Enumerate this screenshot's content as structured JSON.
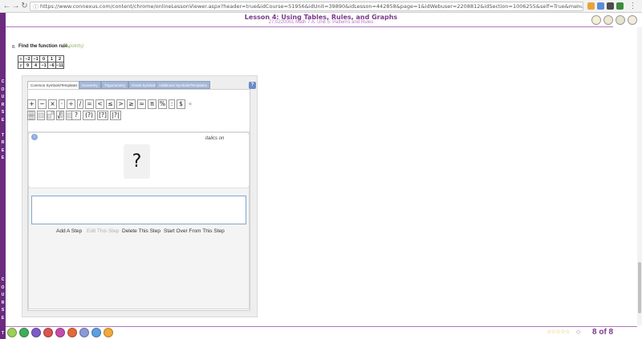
{
  "browser": {
    "url": "https://www.connexus.com/content/chrome/onlineLessonViewer.aspx?header=true&idCourse=51956&idUnit=39890&idLesson=442858&page=1&idWebuser=2208812&idSection=1006255&self=True&menu=off&resizeWindow=true"
  },
  "sidebar": {
    "label_top": [
      "C",
      "O",
      "U",
      "R",
      "S",
      "E",
      "",
      "T",
      "R",
      "E",
      "E"
    ],
    "label_bottom": [
      "C",
      "O",
      "U",
      "R",
      "S",
      "E",
      "",
      "T"
    ]
  },
  "lesson": {
    "title": "Lesson 4: Using Tables, Rules, and Graphs",
    "subtitle": "27.0220001 Math 7 A: Unit 5: Patterns and Rules"
  },
  "question": {
    "number": "8.",
    "prompt": "Find the function rule.",
    "points": "(2 points)",
    "table": {
      "x_label": "x",
      "y_label": "y",
      "x_values": [
        "−2",
        "−1",
        "0",
        "1",
        "2"
      ],
      "y_values": [
        "9",
        "4",
        "−1",
        "−6",
        "−11"
      ]
    }
  },
  "editor": {
    "tabs": [
      "Common Symbols/Templates",
      "Geometry",
      "Trigonometry",
      "Greek Symbols",
      "Additional Symbols/Templates"
    ],
    "help": "?",
    "symbols_row1": [
      "+",
      "−",
      "×",
      "·",
      "÷",
      "/",
      "=",
      "<",
      "≤",
      ">",
      "≥",
      "≈",
      "π",
      "%",
      ":",
      "$",
      "«"
    ],
    "templates_row2": [
      "?",
      "(?)",
      "[?]",
      "|?|"
    ],
    "italics_label": "italics on",
    "placeholder_glyph": "?",
    "info_glyph": "i",
    "step_buttons": {
      "add": "Add A Step",
      "edit": "Edit This Step",
      "delete": "Delete This Step",
      "start_over": "Start Over From This Step"
    }
  },
  "footer": {
    "stars": "☆☆☆☆☆",
    "page_indicator": "8 of 8"
  }
}
